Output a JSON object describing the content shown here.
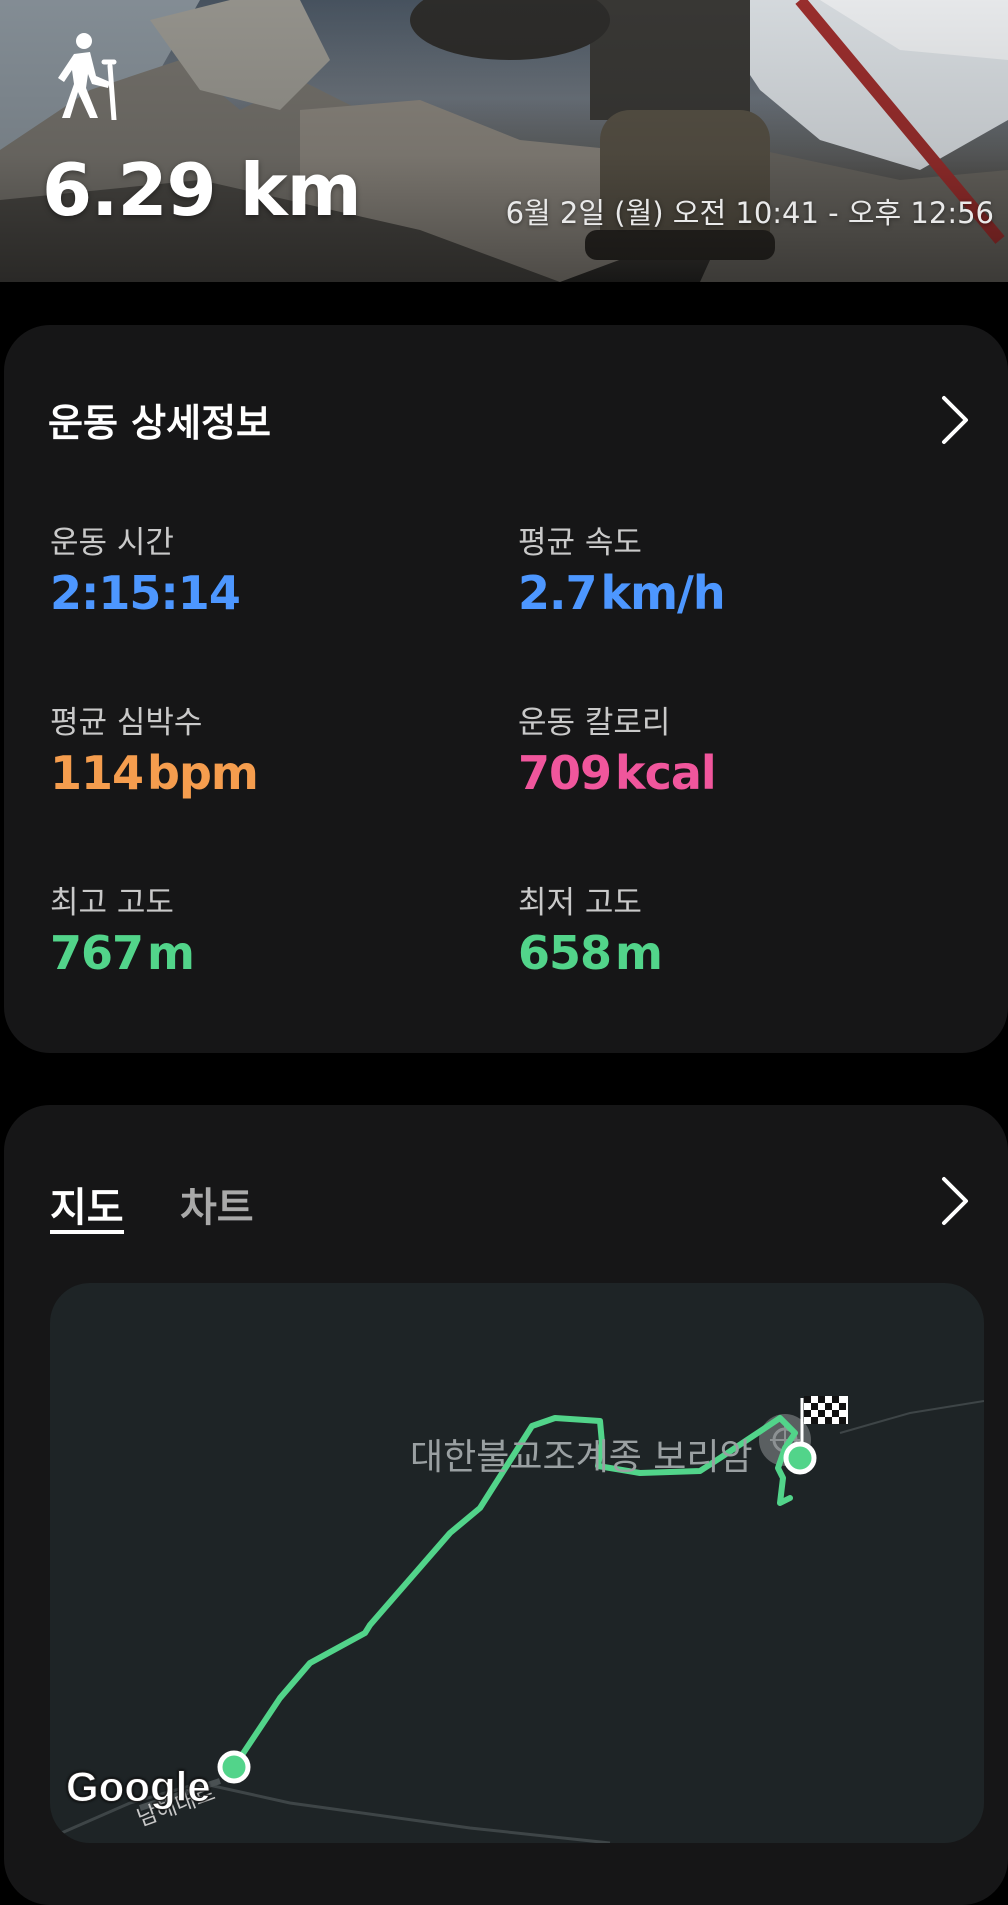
{
  "header": {
    "activity_icon": "hiking-person-icon",
    "distance": "6.29 km",
    "datetime": "6월 2일 (월) 오전 10:41 - 오후 12:56"
  },
  "details": {
    "title": "운동 상세정보",
    "stats": [
      {
        "label": "운동 시간",
        "value": "2:15:14",
        "unit": "",
        "color": "#4d97ff"
      },
      {
        "label": "평균 속도",
        "value": "2.7",
        "unit": "km/h",
        "color": "#4d97ff"
      },
      {
        "label": "평균 심박수",
        "value": "114",
        "unit": "bpm",
        "color": "#f59d4e"
      },
      {
        "label": "운동 칼로리",
        "value": "709",
        "unit": "kcal",
        "color": "#f0569c"
      },
      {
        "label": "최고 고도",
        "value": "767",
        "unit": "m",
        "color": "#52d48a"
      },
      {
        "label": "최저 고도",
        "value": "658",
        "unit": "m",
        "color": "#52d48a"
      }
    ]
  },
  "map_section": {
    "tabs": [
      {
        "label": "지도",
        "selected": true
      },
      {
        "label": "차트",
        "selected": false
      }
    ],
    "place_label": "대한불교조계종 보리암",
    "road_label": "남해대로",
    "attribution": "Google",
    "route_color": "#52d48a"
  }
}
